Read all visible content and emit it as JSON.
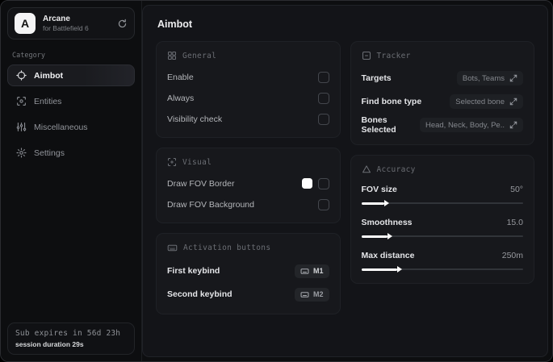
{
  "sidebar": {
    "logo_letter": "A",
    "app_name": "Arcane",
    "app_subtitle": "for Battlefield 6",
    "category_label": "Category",
    "items": [
      {
        "label": "Aimbot"
      },
      {
        "label": "Entities"
      },
      {
        "label": "Miscellaneous"
      },
      {
        "label": "Settings"
      }
    ],
    "footer": {
      "sub_expires": "Sub expires in 56d 23h",
      "session_duration": "session duration 29s"
    }
  },
  "main": {
    "title": "Aimbot",
    "cards": {
      "general": {
        "title": "General",
        "rows": [
          {
            "label": "Enable",
            "checked": false
          },
          {
            "label": "Always",
            "checked": false
          },
          {
            "label": "Visibility check",
            "checked": false
          }
        ]
      },
      "visual": {
        "title": "Visual",
        "rows": [
          {
            "label": "Draw FOV Border",
            "swatch_color": "#ffffff",
            "checked": false
          },
          {
            "label": "Draw FOV Background",
            "checked": false
          }
        ]
      },
      "activation": {
        "title": "Activation buttons",
        "rows": [
          {
            "label": "First keybind",
            "key": "M1"
          },
          {
            "label": "Second keybind",
            "key": "M2"
          }
        ]
      },
      "tracker": {
        "title": "Tracker",
        "rows": [
          {
            "label": "Targets",
            "value": "Bots, Teams"
          },
          {
            "label": "Find bone type",
            "value": "Selected bone"
          },
          {
            "label": "Bones Selected",
            "value": "Head, Neck, Body, Pe.."
          }
        ]
      },
      "accuracy": {
        "title": "Accuracy",
        "sliders": [
          {
            "label": "FOV size",
            "value": "50°",
            "percent": 14
          },
          {
            "label": "Smoothness",
            "value": "15.0",
            "percent": 16
          },
          {
            "label": "Max distance",
            "value": "250m",
            "percent": 22
          }
        ]
      }
    }
  },
  "colors": {
    "accent_swatch": "#ffffff",
    "card_bg": "#17181c",
    "window_bg": "#0d0e10",
    "main_bg": "#131418"
  }
}
